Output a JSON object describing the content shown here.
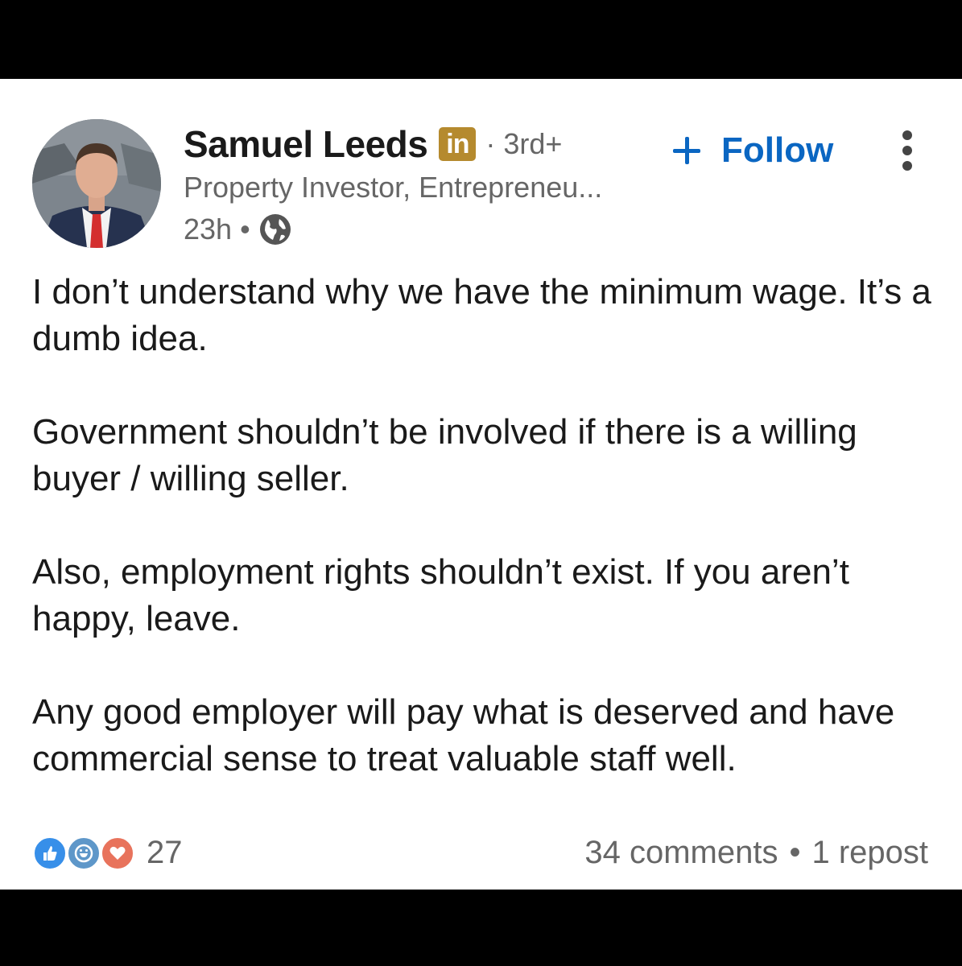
{
  "post": {
    "author": {
      "name": "Samuel Leeds",
      "badge": "in",
      "connection_degree": "3rd+",
      "headline": "Property Investor, Entrepreneu...",
      "posted_ago": "23h",
      "visibility_icon": "globe-icon"
    },
    "follow_label": "Follow",
    "paragraphs": [
      "I don’t understand why we have the minimum wage. It’s a dumb idea.",
      "Government shouldn’t be involved if there is a willing buyer / willing seller.",
      "Also, employment rights shouldn’t exist. If you aren’t happy, leave.",
      "Any good employer will pay what is deserved and have commercial sense to treat valuable staff well."
    ],
    "reactions": {
      "icons": [
        "like-icon",
        "celebrate-icon",
        "love-icon"
      ],
      "count": "27"
    },
    "comments": "34 comments",
    "reposts": "1 repost"
  },
  "colors": {
    "link_blue": "#0a66c2",
    "premium_badge": "#b58a2e",
    "secondary_text": "#666666"
  }
}
